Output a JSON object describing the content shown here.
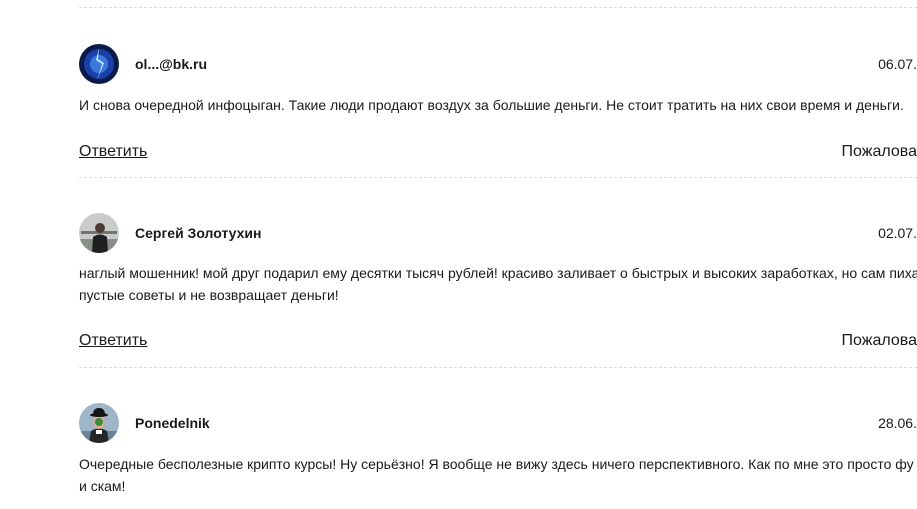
{
  "comments": [
    {
      "author": "ol...@bk.ru",
      "date": "06.07.",
      "text_lines": [
        "И снова очередной инфоцыган. Такие люди продают воздух за большие деньги. Не стоит тратить на них свои время и деньги."
      ],
      "reply_label": "Ответить",
      "report_label": "Пожалова"
    },
    {
      "author": "Сергей Золотухин",
      "date": "02.07.",
      "text_lines": [
        "наглый мошенник! мой друг подарил ему десятки тысяч рублей! красиво заливает о быстрых и высоких заработках, но сам пиха",
        "пустые советы и не возвращает деньги!"
      ],
      "reply_label": "Ответить",
      "report_label": "Пожалова"
    },
    {
      "author": "Ponedelnik",
      "date": "28.06.",
      "text_lines": [
        "Очередные бесполезные крипто курсы! Ну серьёзно! Я вообще не вижу здесь ничего перспективного. Как по мне это просто фу",
        "и скам!"
      ]
    }
  ]
}
